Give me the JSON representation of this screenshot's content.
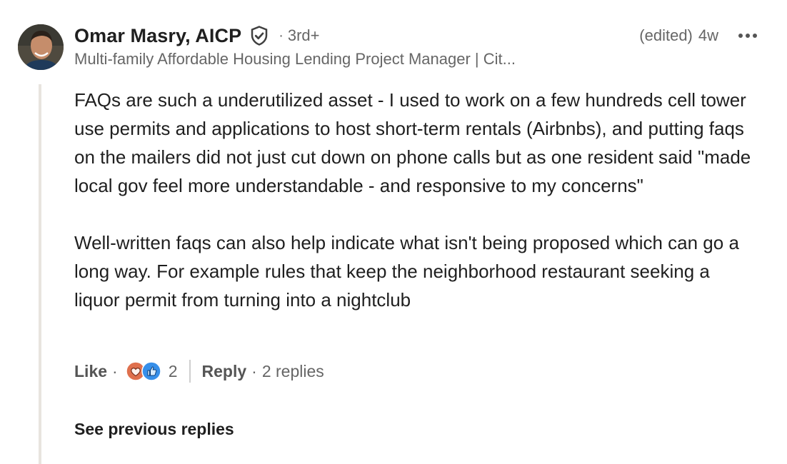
{
  "author": {
    "name": "Omar Masry, AICP",
    "degree": "3rd+",
    "headline": "Multi-family Affordable Housing Lending Project Manager | Cit..."
  },
  "meta": {
    "separator": "·",
    "edited": "(edited)",
    "time": "4w"
  },
  "icons": {
    "verified": "verified-shield-icon",
    "more": "more-options-icon",
    "reaction_love": "love-reaction-icon",
    "reaction_like": "like-reaction-icon"
  },
  "body": {
    "paragraphs": [
      "FAQs are such a underutilized asset - I used to work on a few hundreds cell tower use permits and applications to host short-term rentals (Airbnbs), and putting faqs on the mailers did not just cut down on phone calls but as one resident said \"made local gov feel more understandable - and responsive to my concerns\"",
      "Well-written faqs can also help indicate what isn't being proposed which can go a long way. For example rules that keep the neighborhood restaurant seeking a liquor permit from turning into a nightclub"
    ]
  },
  "actions": {
    "like_label": "Like",
    "separator": "·",
    "reaction_count": "2",
    "reply_label": "Reply",
    "replies_count": "2 replies"
  },
  "footer": {
    "see_previous_label": "See previous replies"
  },
  "colors": {
    "text_primary": "#1f1f1f",
    "text_secondary": "#666666",
    "thread_line": "#e8e4df",
    "love": "#df704d",
    "like": "#378fe9"
  }
}
